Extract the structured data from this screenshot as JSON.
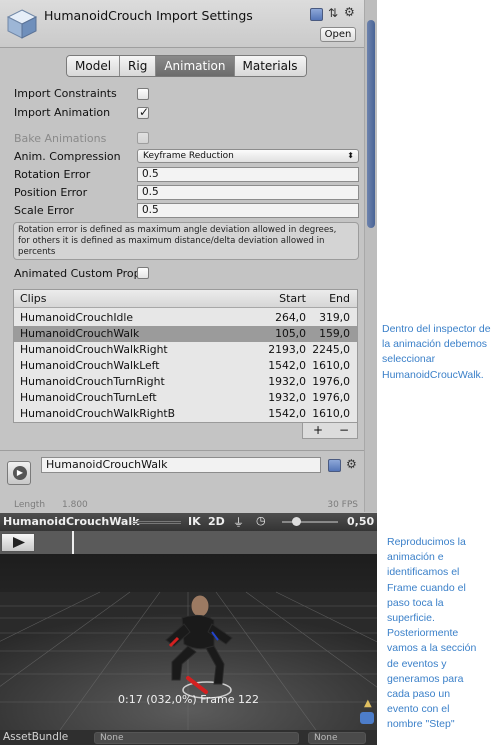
{
  "header": {
    "title": "HumanoidCrouch Import Settings",
    "open_label": "Open",
    "gear_glyph": "⚙"
  },
  "tabs": [
    {
      "label": "Model",
      "active": false
    },
    {
      "label": "Rig",
      "active": false
    },
    {
      "label": "Animation",
      "active": true
    },
    {
      "label": "Materials",
      "active": false
    }
  ],
  "settings": {
    "import_constraints": {
      "label": "Import Constraints",
      "checked": false
    },
    "import_animation": {
      "label": "Import Animation",
      "checked": true
    },
    "bake_animations": {
      "label": "Bake Animations",
      "checked": false
    },
    "anim_compression": {
      "label": "Anim. Compression",
      "value": "Keyframe Reduction"
    },
    "rotation_error": {
      "label": "Rotation Error",
      "value": "0.5"
    },
    "position_error": {
      "label": "Position Error",
      "value": "0.5"
    },
    "scale_error": {
      "label": "Scale Error",
      "value": "0.5"
    },
    "help_text": "Rotation error is defined as maximum angle deviation allowed in degrees,\nfor others it is defined as maximum distance/delta deviation allowed in\npercents",
    "animated_custom_props": {
      "label": "Animated Custom Prop",
      "checked": false
    }
  },
  "clips": {
    "headers": {
      "name": "Clips",
      "start": "Start",
      "end": "End"
    },
    "rows": [
      {
        "name": "HumanoidCrouchIdle",
        "start": "264,0",
        "end": "319,0",
        "selected": false
      },
      {
        "name": "HumanoidCrouchWalk",
        "start": "105,0",
        "end": "159,0",
        "selected": true
      },
      {
        "name": "HumanoidCrouchWalkRight",
        "start": "2193,0",
        "end": "2245,0",
        "selected": false
      },
      {
        "name": "HumanoidCrouchWalkLeft",
        "start": "1542,0",
        "end": "1610,0",
        "selected": false
      },
      {
        "name": "HumanoidCrouchTurnRight",
        "start": "1932,0",
        "end": "1976,0",
        "selected": false
      },
      {
        "name": "HumanoidCrouchTurnLeft",
        "start": "1932,0",
        "end": "1976,0",
        "selected": false
      },
      {
        "name": "HumanoidCrouchWalkRightB",
        "start": "1542,0",
        "end": "1610,0",
        "selected": false
      }
    ],
    "add_label": "+",
    "remove_label": "−"
  },
  "clip_detail": {
    "name": "HumanoidCrouchWalk",
    "length_label": "Length",
    "length_value": "1.800",
    "fps": "30 FPS"
  },
  "preview": {
    "title": "HumanoidCrouchWalk",
    "ik": "IK",
    "two_d": "2D",
    "speed": "0,50",
    "progress": 0.32,
    "speed_slider_position": 0.25,
    "frame_caption": "0:17 (032,0%) Frame 122"
  },
  "asset_bundle": {
    "label": "AssetBundle",
    "bundle_value": "None",
    "variant_value": "None"
  },
  "notes": [
    {
      "text": "Dentro del inspector de\nla animación debemos\nseleccionar\nHumanoidCroucWalk."
    },
    {
      "text": "Reproducimos la\nanimación e\nidentificamos el\nFrame cuando el\npaso toca la\nsuperficie.\nPosteriormente\nvamos a la sección\nde eventos y\ngeneramos para\ncada paso un\nevento con el\nnombre \"Step\""
    }
  ],
  "colors": {
    "note_blue": "#3b80c9",
    "selection_gray": "#9b9b9b",
    "panel_gray": "#c4c4c4"
  }
}
